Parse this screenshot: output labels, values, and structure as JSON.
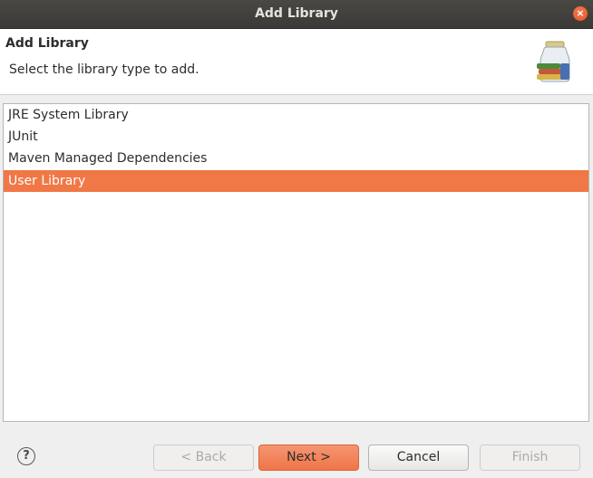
{
  "window": {
    "title": "Add Library",
    "close_glyph": "×"
  },
  "header": {
    "title": "Add Library",
    "description": "Select the library type to add.",
    "icon": "library-jar-icon"
  },
  "library_types": [
    {
      "label": "JRE System Library",
      "selected": false
    },
    {
      "label": "JUnit",
      "selected": false
    },
    {
      "label": "Maven Managed Dependencies",
      "selected": false
    },
    {
      "label": "User Library",
      "selected": true
    }
  ],
  "buttons": {
    "help_glyph": "?",
    "back": "< Back",
    "next": "Next >",
    "cancel": "Cancel",
    "finish": "Finish"
  },
  "colors": {
    "selection": "#f07746",
    "titlebar": "#3e3d39",
    "default_button": "#ef7547"
  }
}
